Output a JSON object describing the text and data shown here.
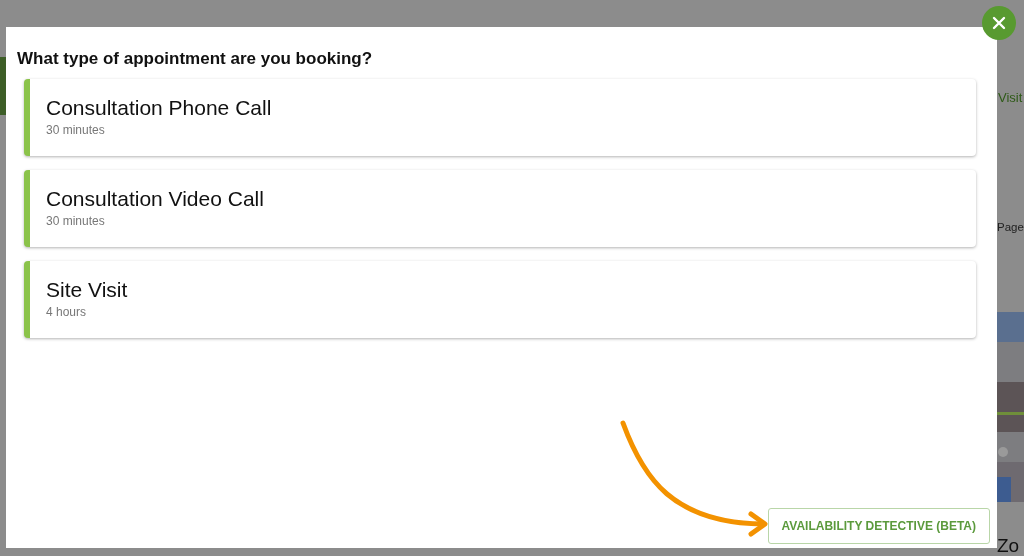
{
  "background_page": {
    "texts": [
      {
        "text": "Visit",
        "kind": "link"
      },
      {
        "text": "Page",
        "kind": "plain"
      },
      {
        "text": "Zo",
        "kind": "heading"
      }
    ]
  },
  "dialog": {
    "title": "What type of appointment are you booking?",
    "options": [
      {
        "name": "Consultation Phone Call",
        "duration": "30 minutes"
      },
      {
        "name": "Consultation Video Call",
        "duration": "30 minutes"
      },
      {
        "name": "Site Visit",
        "duration": "4 hours"
      }
    ],
    "action_button": "AVAILABILITY DETECTIVE (BETA)"
  }
}
